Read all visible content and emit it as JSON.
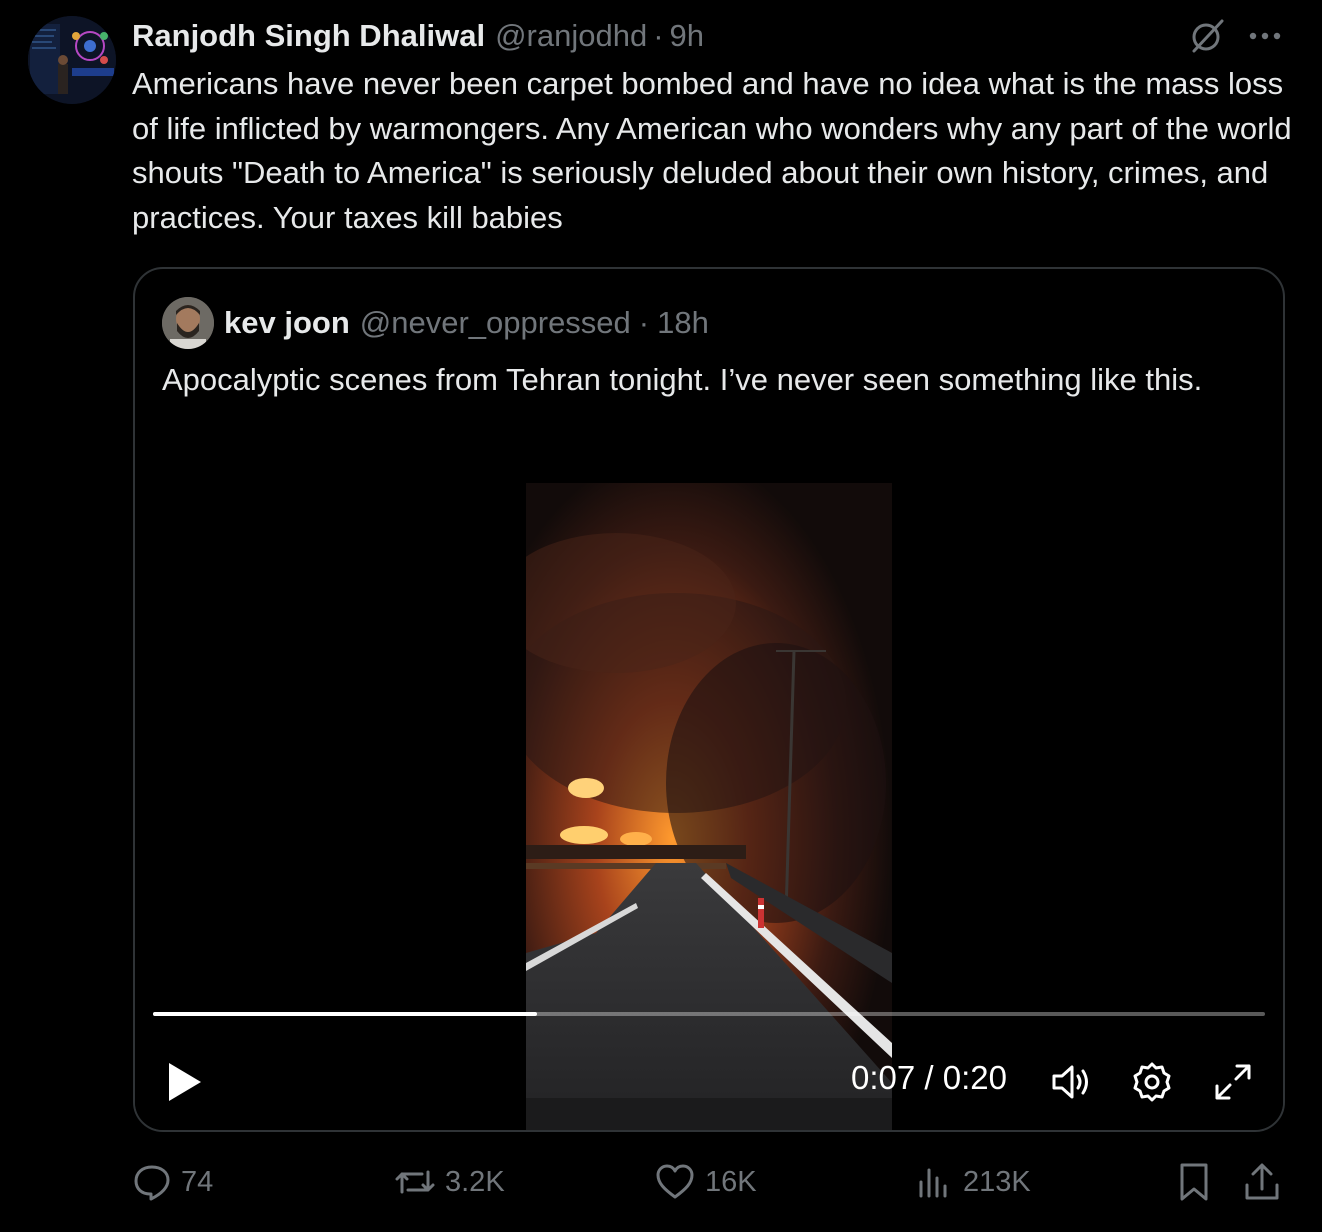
{
  "tweet": {
    "author_name": "Ranjodh Singh Dhaliwal",
    "author_handle": "@ranjodhd",
    "separator": "·",
    "time": "9h",
    "text": "Americans have never been carpet bombed and have no idea what is the mass loss of life inflicted by warmongers. Any American who wonders why any part of the world shouts \"Death to America\" is seriously deluded about their own history, crimes, and practices. Your taxes kill babies",
    "icons": [
      "grok-icon",
      "more-icon"
    ]
  },
  "quote": {
    "author_name": "kev joon",
    "author_handle": "@never_oppressed",
    "separator": "·",
    "time": "18h",
    "text": "Apocalyptic scenes from Tehran tonight. I’ve never seen something like this."
  },
  "video": {
    "time_display": "0:07 / 0:20",
    "progress": 0.345,
    "controls": [
      "play-icon",
      "volume-icon",
      "settings-icon",
      "fullscreen-icon"
    ]
  },
  "actions": {
    "replies": "74",
    "reposts": "3.2K",
    "likes": "16K",
    "views": "213K"
  },
  "colors": {
    "background": "#000000",
    "text": "#e7e9ea",
    "secondary": "#71767b",
    "border": "#2f3336"
  }
}
